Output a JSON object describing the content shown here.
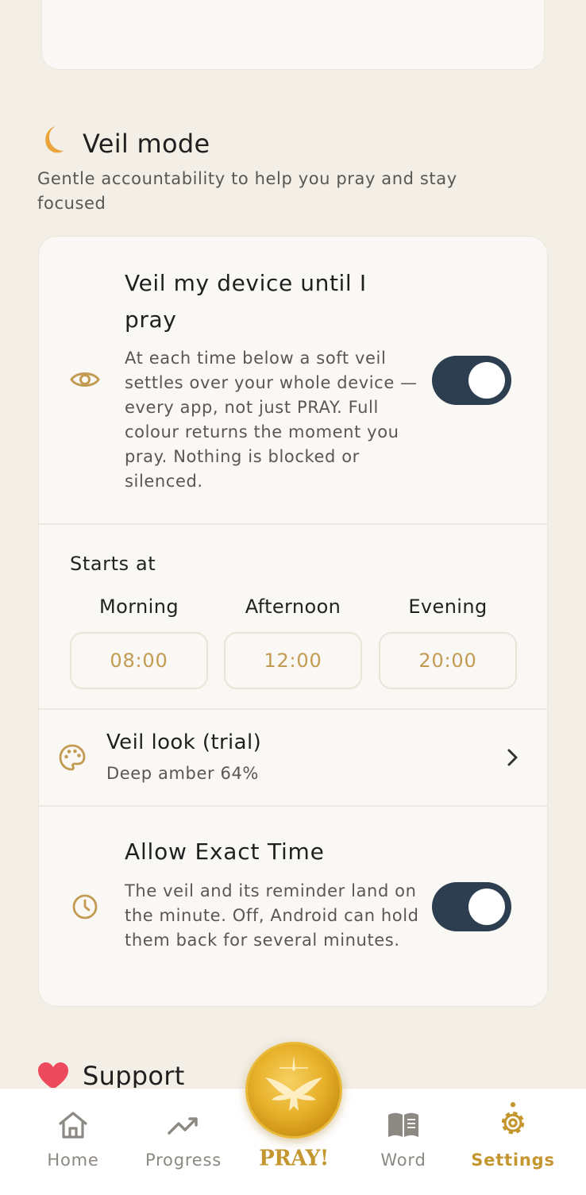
{
  "veil_section": {
    "icon": "crescent-moon-icon",
    "title": "Veil mode",
    "subtitle": "Gentle accountability to help you pray and stay focused"
  },
  "veil_device": {
    "icon": "eye-icon",
    "title": "Veil my device until I pray",
    "description": "At each time below a soft veil settles over your whole device — every app, not just PRAY. Full colour returns the moment you pray. Nothing is blocked or silenced.",
    "enabled": true
  },
  "starts_at": {
    "label": "Starts at",
    "slots": [
      {
        "label": "Morning",
        "time": "08:00"
      },
      {
        "label": "Afternoon",
        "time": "12:00"
      },
      {
        "label": "Evening",
        "time": "20:00"
      }
    ]
  },
  "veil_look": {
    "icon": "palette-icon",
    "title": "Veil look (trial)",
    "subtitle": "Deep amber 64%"
  },
  "exact_time": {
    "icon": "clock-icon",
    "title": "Allow Exact Time",
    "description": "The veil and its reminder land on the minute. Off, Android can hold them back for several minutes.",
    "enabled": true
  },
  "support_section": {
    "icon": "heart-icon",
    "title": "Support"
  },
  "nav": {
    "items": [
      {
        "label": "Home",
        "icon": "home-icon"
      },
      {
        "label": "Progress",
        "icon": "trending-up-icon"
      },
      {
        "label": "PRAY!",
        "icon": "dove-icon"
      },
      {
        "label": "Word",
        "icon": "book-icon"
      },
      {
        "label": "Settings",
        "icon": "gear-icon",
        "active": true
      }
    ]
  },
  "colors": {
    "background": "#F3EFE6",
    "card": "#FAF8F4",
    "accent_gold": "#C4962F",
    "toggle_on": "#2C3E50"
  }
}
